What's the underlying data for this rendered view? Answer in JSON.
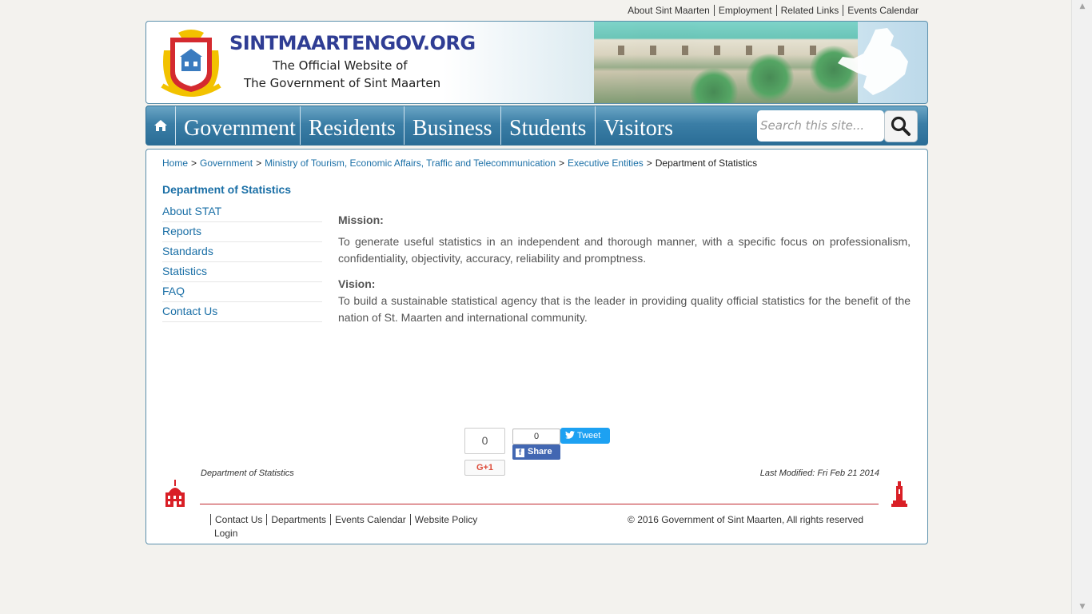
{
  "top_links": [
    "About Sint Maarten",
    "Employment",
    "Related Links",
    "Events Calendar"
  ],
  "header": {
    "site_name": "SINTMAARTENGOV.ORG",
    "tagline_1": "The Official Website of",
    "tagline_2": "The Government of Sint Maarten"
  },
  "nav": {
    "items": [
      "Government",
      "Residents",
      "Business",
      "Students",
      "Visitors"
    ],
    "search_placeholder": "Search this site..."
  },
  "breadcrumb": {
    "items": [
      "Home",
      "Government",
      "Ministry of Tourism, Economic Affairs, Traffic and Telecommunication",
      "Executive Entities"
    ],
    "current": "Department of Statistics",
    "separator": ">"
  },
  "sidebar": {
    "title": "Department of Statistics",
    "items": [
      "About STAT",
      "Reports",
      "Standards",
      "Statistics",
      "FAQ",
      "Contact Us"
    ]
  },
  "content": {
    "mission_title": "Mission:",
    "mission_text": "To generate useful statistics in an independent and thorough manner, with a specific focus on professionalism, confidentiality, objectivity, accuracy, reliability and promptness.",
    "vision_title": "Vision:",
    "vision_text": "To build a sustainable statistical agency that is the leader in providing quality official statistics for the benefit of the nation of St. Maarten and international community."
  },
  "social": {
    "gplus_count": "0",
    "gplus_label": "G+1",
    "fb_count": "0",
    "fb_share": "Share",
    "tweet": "Tweet"
  },
  "footer": {
    "dept": "Department of Statistics",
    "modified": "Last Modified: Fri Feb 21 2014",
    "links": [
      "Contact Us",
      "Departments",
      "Events Calendar",
      "Website Policy"
    ],
    "login": "Login",
    "copyright": "© 2016 Government of Sint Maarten, All rights reserved"
  },
  "colors": {
    "link": "#1a6fa6",
    "nav": "#3b7ea6",
    "footer_line": "#c0272d"
  }
}
